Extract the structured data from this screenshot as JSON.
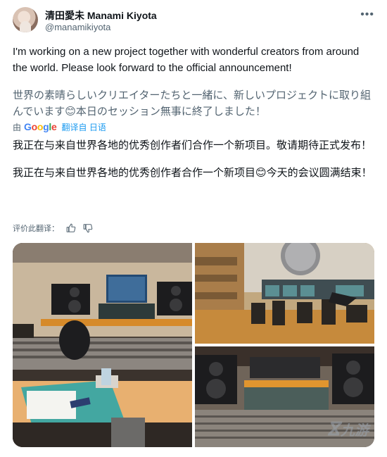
{
  "author": {
    "display_name": "清田愛未 Manami Kiyota",
    "handle": "@manamikiyota"
  },
  "tweet": {
    "text_en": "I'm working on a new project together with wonderful creators from around the world. Please look forward to the official announcement!",
    "text_jp_part1": "世界の素晴らしいクリエイターたちと一緒に、新しいプロジェクトに取り組んでいます",
    "emoji": "😊",
    "text_jp_part2": "本日のセッション無事に終了しました！"
  },
  "translation_bar": {
    "by_label": "由",
    "google_letters": [
      "G",
      "o",
      "o",
      "g",
      "l",
      "e"
    ],
    "translated_label": "翻译自 日语"
  },
  "translation": {
    "para1": "我正在与来自世界各地的优秀创作者们合作一个新项目。敬请期待正式发布！",
    "para2_part1": "我正在与来自世界各地的优秀创作者合作一个新项目",
    "para2_part2": "今天的会议圆满结束！"
  },
  "rate": {
    "label": "评价此翻译："
  },
  "icons": {
    "more": "more-dots-icon",
    "like": "thumbs-up-icon",
    "dislike": "thumbs-down-icon"
  },
  "watermark": {
    "text": "九游"
  }
}
